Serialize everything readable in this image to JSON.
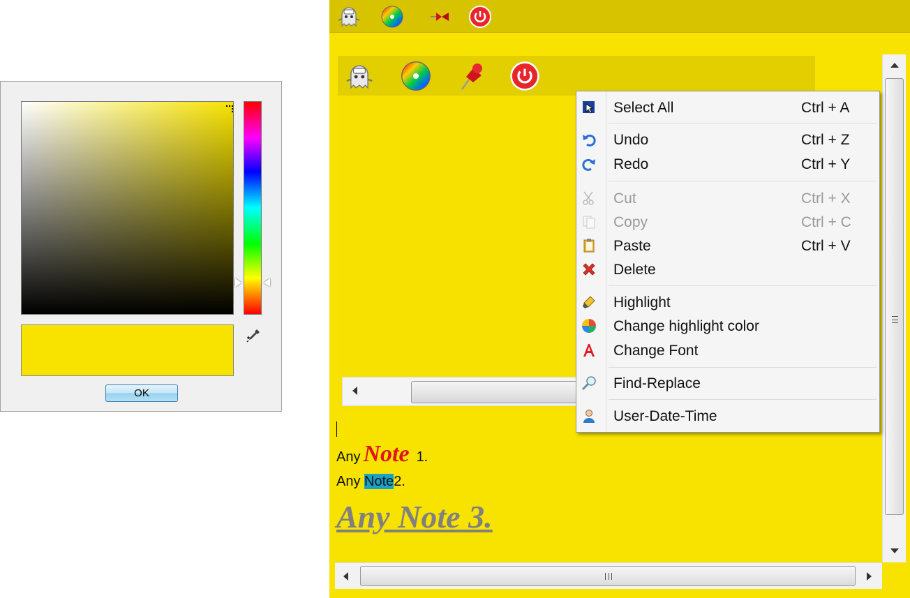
{
  "color_picker": {
    "ok_label": "OK",
    "selected_color": "#f7e200",
    "icons": {
      "eyedropper": "eyedropper-icon"
    }
  },
  "note_window": {
    "background_color": "#f7e200",
    "toolbar_icons": [
      "ghost-icon",
      "color-wheel-icon",
      "pin-icon",
      "power-icon"
    ],
    "lines": {
      "line1_prefix": "Any",
      "line1_fancy": "Note",
      "line1_suffix": "1.",
      "line2_prefix": "Any",
      "line2_highlight": "Note",
      "line2_suffix": "2.",
      "line3": "Any Note 3."
    },
    "highlight_color": "#1aa3c8"
  },
  "context_menu": {
    "items": [
      {
        "label": "Select All",
        "shortcut": "Ctrl + A",
        "icon": "select-all-icon",
        "enabled": true
      },
      {
        "label": "Undo",
        "shortcut": "Ctrl + Z",
        "icon": "undo-icon",
        "enabled": true
      },
      {
        "label": "Redo",
        "shortcut": "Ctrl + Y",
        "icon": "redo-icon",
        "enabled": true
      },
      {
        "label": "Cut",
        "shortcut": "Ctrl + X",
        "icon": "scissors-icon",
        "enabled": false
      },
      {
        "label": "Copy",
        "shortcut": "Ctrl + C",
        "icon": "copy-icon",
        "enabled": false
      },
      {
        "label": "Paste",
        "shortcut": "Ctrl + V",
        "icon": "paste-icon",
        "enabled": true
      },
      {
        "label": "Delete",
        "shortcut": "",
        "icon": "delete-icon",
        "enabled": true
      },
      {
        "label": "Highlight",
        "shortcut": "",
        "icon": "highlighter-icon",
        "enabled": true
      },
      {
        "label": "Change highlight color",
        "shortcut": "",
        "icon": "color-palette-icon",
        "enabled": true
      },
      {
        "label": "Change Font",
        "shortcut": "",
        "icon": "font-icon",
        "enabled": true
      },
      {
        "label": "Find-Replace",
        "shortcut": "",
        "icon": "magnifier-icon",
        "enabled": true
      },
      {
        "label": "User-Date-Time",
        "shortcut": "",
        "icon": "user-icon",
        "enabled": true
      }
    ]
  }
}
